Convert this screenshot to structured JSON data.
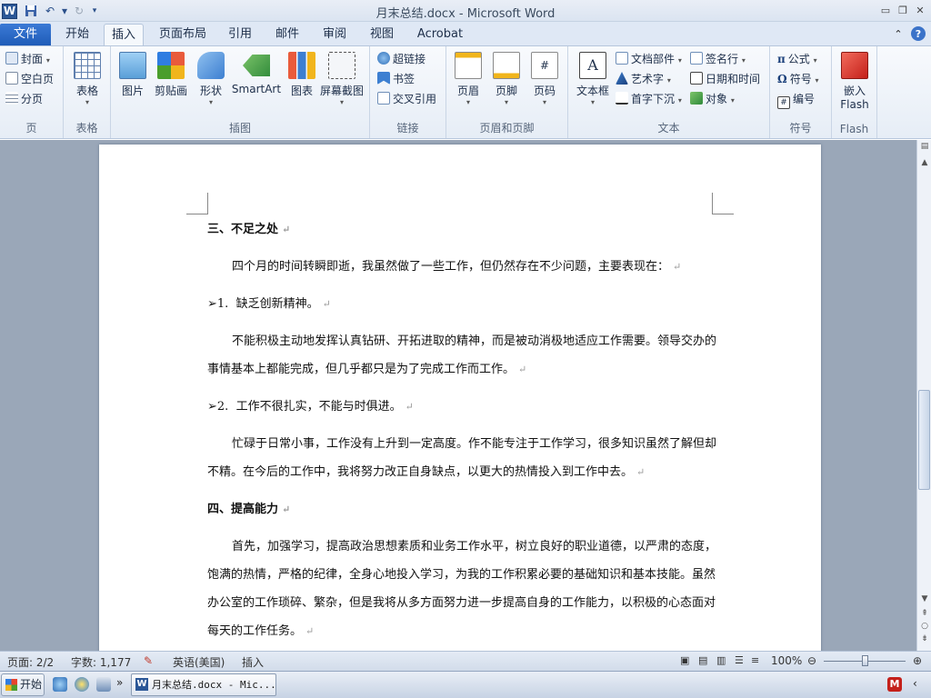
{
  "window": {
    "title": "月末总结.docx - Microsoft Word",
    "app_icon_letter": "W"
  },
  "tabs": [
    "文件",
    "开始",
    "插入",
    "页面布局",
    "引用",
    "邮件",
    "审阅",
    "视图",
    "Acrobat"
  ],
  "active_tab": "插入",
  "ribbon": {
    "pages": {
      "group_label": "页",
      "items": [
        "封面",
        "空白页",
        "分页"
      ]
    },
    "tables": {
      "group_label": "表格",
      "table_label": "表格"
    },
    "illustrations": {
      "group_label": "插图",
      "items": [
        "图片",
        "剪贴画",
        "形状",
        "SmartArt",
        "图表",
        "屏幕截图"
      ]
    },
    "links": {
      "group_label": "链接",
      "items": [
        "超链接",
        "书签",
        "交叉引用"
      ]
    },
    "header_footer": {
      "group_label": "页眉和页脚",
      "items": [
        "页眉",
        "页脚",
        "页码"
      ]
    },
    "text": {
      "group_label": "文本",
      "textbox_label": "文本框",
      "col1": [
        "文档部件",
        "艺术字",
        "首字下沉"
      ],
      "col2": [
        "签名行",
        "日期和时间",
        "对象"
      ]
    },
    "symbols": {
      "group_label": "符号",
      "items": [
        "公式",
        "符号",
        "编号"
      ]
    },
    "flash": {
      "group_label": "Flash",
      "embed_label_line1": "嵌入",
      "embed_label_line2": "Flash"
    }
  },
  "document": {
    "heading3": "三、不足之处",
    "para_intro": "四个月的时间转瞬即逝，我虽然做了一些工作，但仍然存在不少问题，主要表现在：",
    "item1_bullet": "➢1.",
    "item1_text": "缺乏创新精神。",
    "para_item1": "不能积极主动地发挥认真钻研、开拓进取的精神，而是被动消极地适应工作需要。领导交办的事情基本上都能完成，但几乎都只是为了完成工作而工作。",
    "item2_bullet": "➢2.",
    "item2_text": "工作不很扎实，不能与时俱进。",
    "para_item2": "忙碌于日常小事，工作没有上升到一定高度。作不能专注于工作学习，很多知识虽然了解但却不精。在今后的工作中，我将努力改正自身缺点，以更大的热情投入到工作中去。",
    "heading4": "四、提高能力",
    "para_improve": "首先，加强学习，提高政治思想素质和业务工作水平，树立良好的职业道德，以严肃的态度，饱满的热情，严格的纪律，全身心地投入学习，为我的工作积累必要的基础知识和基本技能。虽然办公室的工作琐碎、繁杂，但是我将从多方面努力进一步提高自身的工作能力，以积极的心态面对每天的工作任务。",
    "paragraph_mark": "↵"
  },
  "status_bar": {
    "page": "页面: 2/2",
    "words": "字数: 1,177",
    "language": "英语(美国)",
    "mode": "插入",
    "zoom": "100%",
    "zoom_fraction": 0.5
  },
  "taskbar": {
    "start_label": "开始",
    "active_window": "月末总结.docx - Mic..."
  },
  "colors": {
    "file_tab": "#1f5cb8",
    "accent": "#2b5797",
    "doc_background": "#9aa7b8"
  }
}
